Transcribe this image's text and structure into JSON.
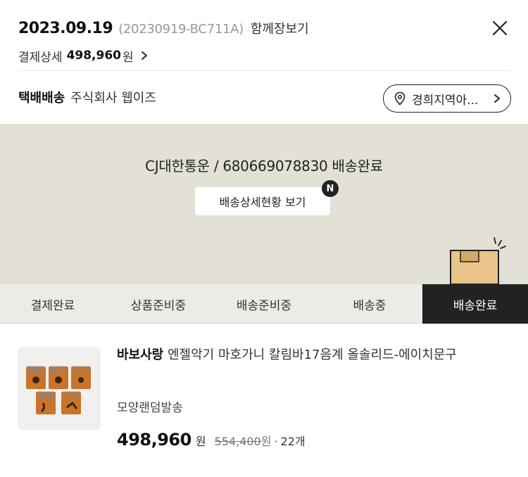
{
  "header": {
    "date": "2023.09.19",
    "order_code": "(20230919-BC711A)",
    "together_link": "함께장보기",
    "payment_label": "결제상세",
    "payment_amount": "498,960",
    "payment_unit": "원"
  },
  "shipping": {
    "method": "택배배송",
    "seller": "주식회사 웹이즈",
    "region_button": "경희지역아..."
  },
  "status_panel": {
    "tracking_text": "CJ대한통운 / 680669078830 배송완료",
    "detail_button": "배송상세현황 보기",
    "new_badge": "N"
  },
  "tabs": [
    {
      "label": "결제완료",
      "active": false
    },
    {
      "label": "상품준비중",
      "active": false
    },
    {
      "label": "배송준비중",
      "active": false
    },
    {
      "label": "배송중",
      "active": false
    },
    {
      "label": "배송완료",
      "active": true
    }
  ],
  "product": {
    "brand": "바보사랑",
    "name": "엔젤악기 마호가니 칼림바17음계 올솔리드-에이치문구",
    "option": "모양랜덤발송",
    "price": "498,960",
    "price_unit": "원",
    "original_price": "554,400",
    "original_unit": "원",
    "separator": "·",
    "quantity": "22개"
  },
  "icons": {
    "close": "close-icon",
    "chevron": "chevron-right-icon",
    "location": "location-pin-icon",
    "box": "delivery-box-icon"
  },
  "colors": {
    "panel_bg": "#e3e0d6",
    "active_tab_bg": "#222222",
    "tabs_bg": "#ecebe6"
  }
}
